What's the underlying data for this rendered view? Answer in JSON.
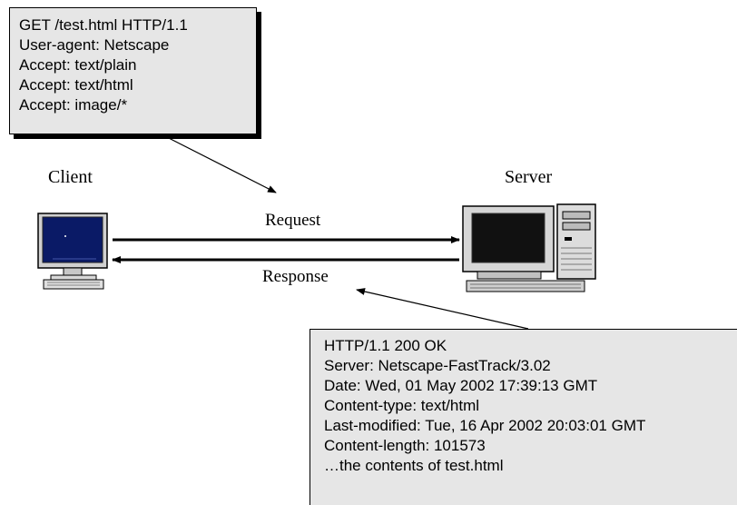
{
  "diagram": {
    "client_label": "Client",
    "server_label": "Server",
    "request_label": "Request",
    "response_label": "Response",
    "request_message": [
      "GET /test.html HTTP/1.1",
      "User-agent: Netscape",
      "Accept: text/plain",
      "Accept: text/html",
      "Accept: image/*"
    ],
    "response_message": [
      "HTTP/1.1 200 OK",
      "Server: Netscape-FastTrack/3.02",
      "Date: Wed, 01 May 2002 17:39:13 GMT",
      "Content-type: text/html",
      "Last-modified: Tue, 16 Apr 2002 20:03:01 GMT",
      "Content-length: 101573",
      "…the contents of test.html"
    ]
  },
  "icons": {
    "client": "client-computer-icon",
    "server": "server-computer-icon"
  }
}
